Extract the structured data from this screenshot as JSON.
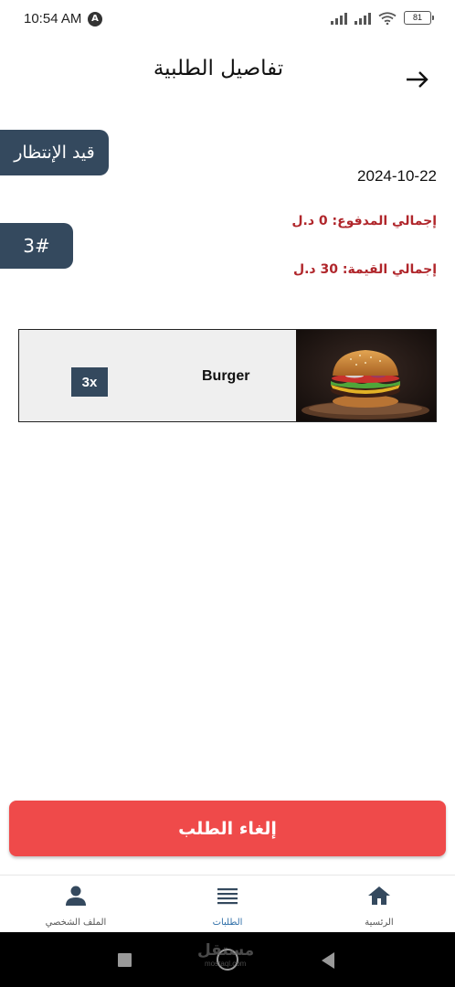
{
  "status_bar": {
    "time": "10:54 AM",
    "app_badge": "A",
    "battery": "81"
  },
  "header": {
    "title": "تفاصيل الطلبية",
    "back_icon": "arrow-right-icon"
  },
  "order": {
    "status": "قيد الإنتظار",
    "number": "3#",
    "date": "2024-10-22",
    "total_paid": "إجمالي المدفوع: 0 د.ل",
    "total_value": "إجمالي القيمة: 30 د.ل",
    "items": [
      {
        "quantity": "3x",
        "name": "Burger",
        "image_icon": "burger-photo"
      }
    ]
  },
  "actions": {
    "cancel_label": "إلغاء الطلب"
  },
  "bottom_nav": {
    "items": [
      {
        "label": "الملف الشخصي",
        "icon": "person-icon"
      },
      {
        "label": "الطلبات",
        "icon": "list-icon",
        "active": true
      },
      {
        "label": "الرئسية",
        "icon": "home-icon"
      }
    ]
  },
  "watermark": {
    "text": "مستقل",
    "sub": "mostaql.com"
  },
  "colors": {
    "primary_dark": "#34495e",
    "danger": "#ef4a4a",
    "price_text": "#b0262b",
    "active_nav": "#2f6fa8"
  }
}
